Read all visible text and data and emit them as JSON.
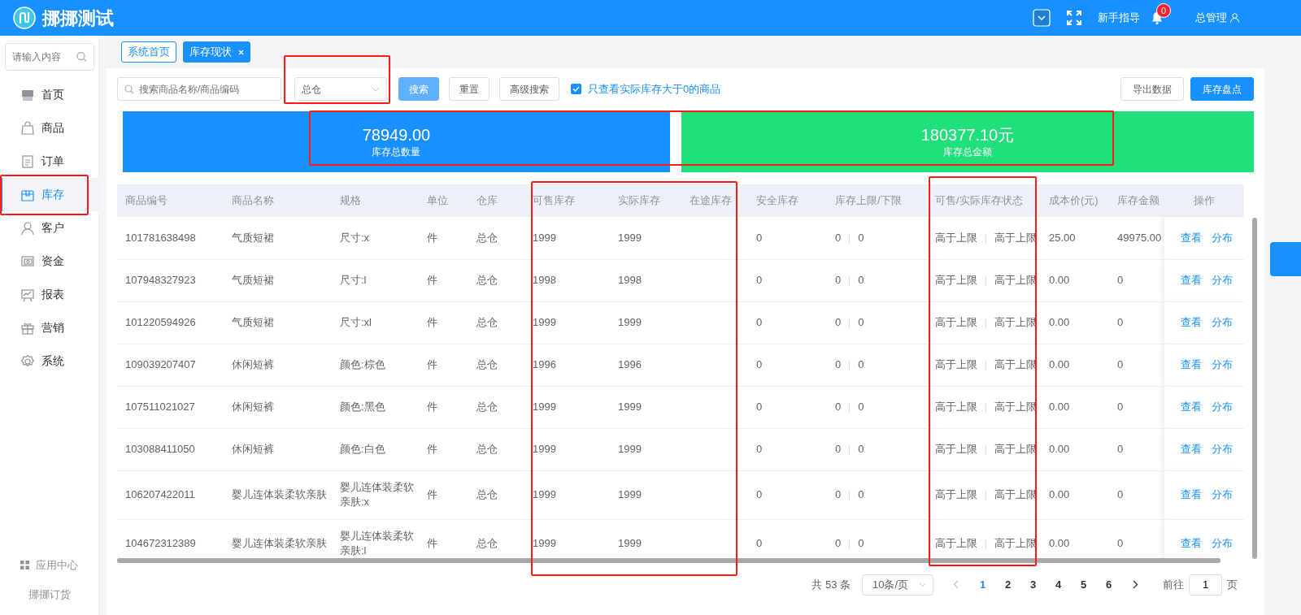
{
  "header": {
    "title": "挪挪测试",
    "guide": "新手指导",
    "notification_count": "0",
    "user": "总管理"
  },
  "sidebar": {
    "search_placeholder": "请输入内容",
    "items": [
      {
        "label": "首页",
        "selected": false
      },
      {
        "label": "商品",
        "selected": false
      },
      {
        "label": "订单",
        "selected": false
      },
      {
        "label": "库存",
        "selected": true
      },
      {
        "label": "客户",
        "selected": false
      },
      {
        "label": "资金",
        "selected": false
      },
      {
        "label": "报表",
        "selected": false
      },
      {
        "label": "营销",
        "selected": false
      },
      {
        "label": "系统",
        "selected": false
      }
    ],
    "app_center": "应用中心",
    "footer": "挪挪订货"
  },
  "tabs": [
    {
      "label": "系统首页",
      "selected": false,
      "closable": false
    },
    {
      "label": "库存现状",
      "selected": true,
      "closable": true
    }
  ],
  "toolbar": {
    "search_placeholder": "搜索商品名称/商品编码",
    "warehouse": "总仓",
    "buttons": [
      {
        "label": "搜索",
        "kind": "primary-light"
      },
      {
        "label": "重置",
        "kind": "default"
      },
      {
        "label": "高级搜索",
        "kind": "default"
      }
    ],
    "filter": {
      "label": "只查看实际库存大于0的商品",
      "checked": true
    },
    "right_buttons": [
      {
        "label": "导出数据",
        "kind": "default"
      },
      {
        "label": "库存盘点",
        "kind": "primary"
      }
    ]
  },
  "summary": [
    {
      "value": "78949.00",
      "label": "库存总数量",
      "color": "#1890ff"
    },
    {
      "value": "180377.10元",
      "label": "库存总金额",
      "color": "#1fe07a"
    }
  ],
  "table": {
    "columns": [
      "商品编号",
      "商品名称",
      "规格",
      "单位",
      "仓库",
      "可售库存",
      "实际库存",
      "在途库存",
      "安全库存",
      "库存上限/下限",
      "可售/实际库存状态",
      "成本价(元)",
      "库存金额",
      "操作"
    ],
    "rows": [
      {
        "code": "101781638498",
        "name": "气质短裙",
        "spec": "尺寸:x",
        "unit": "件",
        "warehouse": "总仓",
        "sellable": "1999",
        "actual": "1999",
        "safety": "0",
        "upper": "0",
        "lower": "0",
        "sell_status": "高于上限",
        "actual_status": "高于上限",
        "cost": "25.00",
        "amount": "49975.00",
        "actions": [
          "查看",
          "分布"
        ]
      },
      {
        "code": "107948327923",
        "name": "气质短裙",
        "spec": "尺寸:l",
        "unit": "件",
        "warehouse": "总仓",
        "sellable": "1998",
        "actual": "1998",
        "safety": "0",
        "upper": "0",
        "lower": "0",
        "sell_status": "高于上限",
        "actual_status": "高于上限",
        "cost": "0.00",
        "amount": "0",
        "actions": [
          "查看",
          "分布"
        ]
      },
      {
        "code": "101220594926",
        "name": "气质短裙",
        "spec": "尺寸:xl",
        "unit": "件",
        "warehouse": "总仓",
        "sellable": "1999",
        "actual": "1999",
        "safety": "0",
        "upper": "0",
        "lower": "0",
        "sell_status": "高于上限",
        "actual_status": "高于上限",
        "cost": "0.00",
        "amount": "0",
        "actions": [
          "查看",
          "分布"
        ]
      },
      {
        "code": "109039207407",
        "name": "休闲短裤",
        "spec": "颜色:棕色",
        "unit": "件",
        "warehouse": "总仓",
        "sellable": "1996",
        "actual": "1996",
        "safety": "0",
        "upper": "0",
        "lower": "0",
        "sell_status": "高于上限",
        "actual_status": "高于上限",
        "cost": "0.00",
        "amount": "0",
        "actions": [
          "查看",
          "分布"
        ]
      },
      {
        "code": "107511021027",
        "name": "休闲短裤",
        "spec": "颜色:黑色",
        "unit": "件",
        "warehouse": "总仓",
        "sellable": "1999",
        "actual": "1999",
        "safety": "0",
        "upper": "0",
        "lower": "0",
        "sell_status": "高于上限",
        "actual_status": "高于上限",
        "cost": "0.00",
        "amount": "0",
        "actions": [
          "查看",
          "分布"
        ]
      },
      {
        "code": "103088411050",
        "name": "休闲短裤",
        "spec": "颜色:白色",
        "unit": "件",
        "warehouse": "总仓",
        "sellable": "1999",
        "actual": "1999",
        "safety": "0",
        "upper": "0",
        "lower": "0",
        "sell_status": "高于上限",
        "actual_status": "高于上限",
        "cost": "0.00",
        "amount": "0",
        "actions": [
          "查看",
          "分布"
        ]
      },
      {
        "code": "106207422011",
        "name": "婴儿连体装柔软亲肤",
        "spec": "婴儿连体装柔软亲肤:x",
        "unit": "件",
        "warehouse": "总仓",
        "sellable": "1999",
        "actual": "1999",
        "safety": "0",
        "upper": "0",
        "lower": "0",
        "sell_status": "高于上限",
        "actual_status": "高于上限",
        "cost": "0.00",
        "amount": "0",
        "actions": [
          "查看",
          "分布"
        ]
      },
      {
        "code": "104672312389",
        "name": "婴儿连体装柔软亲肤",
        "spec": "婴儿连体装柔软亲肤:l",
        "unit": "件",
        "warehouse": "总仓",
        "sellable": "1999",
        "actual": "1999",
        "safety": "0",
        "upper": "0",
        "lower": "0",
        "sell_status": "高于上限",
        "actual_status": "高于上限",
        "cost": "0.00",
        "amount": "0",
        "actions": [
          "查看",
          "分布"
        ]
      }
    ]
  },
  "pagination": {
    "total": "共 53 条",
    "page_size": "10条/页",
    "pages": [
      {
        "label": "1",
        "selected": true
      },
      {
        "label": "2",
        "selected": false
      },
      {
        "label": "3",
        "selected": false
      },
      {
        "label": "4",
        "selected": false
      },
      {
        "label": "5",
        "selected": false
      },
      {
        "label": "6",
        "selected": false
      }
    ],
    "goto_label": "前往",
    "goto_value": "1",
    "goto_suffix": "页"
  },
  "annotations": {
    "warehouse_select": true,
    "summary": true,
    "sidebar_selected": true,
    "stock_columns": true,
    "status_column": true
  }
}
